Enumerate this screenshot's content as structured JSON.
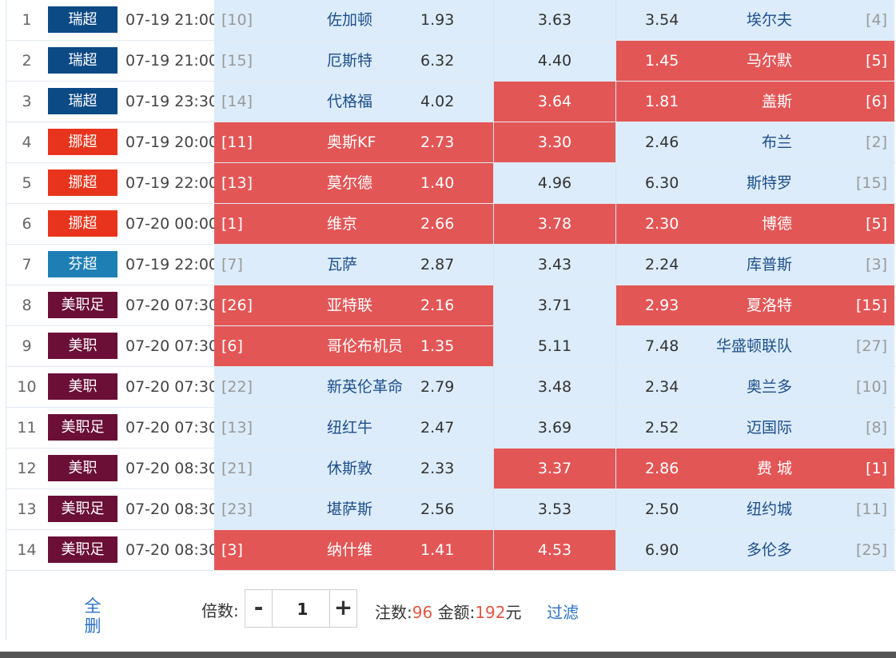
{
  "colors": {
    "league_瑞超": "#0c4a86",
    "league_挪超": "#e8341c",
    "league_芬超": "#1e7fb4",
    "league_美职": "#6b0f37",
    "cell_normal": "#dcecfa",
    "cell_selected": "#e35656"
  },
  "matches": [
    {
      "idx": "1",
      "league": "瑞超",
      "league_color": "#0c4a86",
      "time": "07-19 21:00",
      "home_rank": "[10]",
      "home_team": "佐加顿",
      "home_odds": "1.93",
      "draw_odds": "3.63",
      "away_odds": "3.54",
      "away_team": "埃尔夫",
      "away_rank": "[4]",
      "home_sel": false,
      "draw_sel": false,
      "away_sel": false
    },
    {
      "idx": "2",
      "league": "瑞超",
      "league_color": "#0c4a86",
      "time": "07-19 21:00",
      "home_rank": "[15]",
      "home_team": "厄斯特",
      "home_odds": "6.32",
      "draw_odds": "4.40",
      "away_odds": "1.45",
      "away_team": "马尔默",
      "away_rank": "[5]",
      "home_sel": false,
      "draw_sel": false,
      "away_sel": true
    },
    {
      "idx": "3",
      "league": "瑞超",
      "league_color": "#0c4a86",
      "time": "07-19 23:30",
      "home_rank": "[14]",
      "home_team": "代格福",
      "home_odds": "4.02",
      "draw_odds": "3.64",
      "away_odds": "1.81",
      "away_team": "盖斯",
      "away_rank": "[6]",
      "home_sel": false,
      "draw_sel": true,
      "away_sel": true
    },
    {
      "idx": "4",
      "league": "挪超",
      "league_color": "#e8341c",
      "time": "07-19 20:00",
      "home_rank": "[11]",
      "home_team": "奥斯KF",
      "home_odds": "2.73",
      "draw_odds": "3.30",
      "away_odds": "2.46",
      "away_team": "布兰",
      "away_rank": "[2]",
      "home_sel": true,
      "draw_sel": true,
      "away_sel": false
    },
    {
      "idx": "5",
      "league": "挪超",
      "league_color": "#e8341c",
      "time": "07-19 22:00",
      "home_rank": "[13]",
      "home_team": "莫尔德",
      "home_odds": "1.40",
      "draw_odds": "4.96",
      "away_odds": "6.30",
      "away_team": "斯特罗",
      "away_rank": "[15]",
      "home_sel": true,
      "draw_sel": false,
      "away_sel": false
    },
    {
      "idx": "6",
      "league": "挪超",
      "league_color": "#e8341c",
      "time": "07-20 00:00",
      "home_rank": "[1]",
      "home_team": "维京",
      "home_odds": "2.66",
      "draw_odds": "3.78",
      "away_odds": "2.30",
      "away_team": "博德",
      "away_rank": "[5]",
      "home_sel": true,
      "draw_sel": true,
      "away_sel": true
    },
    {
      "idx": "7",
      "league": "芬超",
      "league_color": "#1e7fb4",
      "time": "07-19 22:00",
      "home_rank": "[7]",
      "home_team": "瓦萨",
      "home_odds": "2.87",
      "draw_odds": "3.43",
      "away_odds": "2.24",
      "away_team": "库普斯",
      "away_rank": "[3]",
      "home_sel": false,
      "draw_sel": false,
      "away_sel": false
    },
    {
      "idx": "8",
      "league": "美职足",
      "league_color": "#6b0f37",
      "time": "07-20 07:30",
      "home_rank": "[26]",
      "home_team": "亚特联",
      "home_odds": "2.16",
      "draw_odds": "3.71",
      "away_odds": "2.93",
      "away_team": "夏洛特",
      "away_rank": "[15]",
      "home_sel": true,
      "draw_sel": false,
      "away_sel": true
    },
    {
      "idx": "9",
      "league": "美职",
      "league_color": "#6b0f37",
      "time": "07-20 07:30",
      "home_rank": "[6]",
      "home_team": "哥伦布机员",
      "home_odds": "1.35",
      "draw_odds": "5.11",
      "away_odds": "7.48",
      "away_team": "华盛顿联队",
      "away_rank": "[27]",
      "home_sel": true,
      "draw_sel": false,
      "away_sel": false
    },
    {
      "idx": "10",
      "league": "美职",
      "league_color": "#6b0f37",
      "time": "07-20 07:30",
      "home_rank": "[22]",
      "home_team": "新英伦革命",
      "home_odds": "2.79",
      "draw_odds": "3.48",
      "away_odds": "2.34",
      "away_team": "奥兰多",
      "away_rank": "[10]",
      "home_sel": false,
      "draw_sel": false,
      "away_sel": false
    },
    {
      "idx": "11",
      "league": "美职足",
      "league_color": "#6b0f37",
      "time": "07-20 07:30",
      "home_rank": "[13]",
      "home_team": "纽红牛",
      "home_odds": "2.47",
      "draw_odds": "3.69",
      "away_odds": "2.52",
      "away_team": "迈国际",
      "away_rank": "[8]",
      "home_sel": false,
      "draw_sel": false,
      "away_sel": false
    },
    {
      "idx": "12",
      "league": "美职",
      "league_color": "#6b0f37",
      "time": "07-20 08:30",
      "home_rank": "[21]",
      "home_team": "休斯敦",
      "home_odds": "2.33",
      "draw_odds": "3.37",
      "away_odds": "2.86",
      "away_team": "费 城",
      "away_rank": "[1]",
      "home_sel": false,
      "draw_sel": true,
      "away_sel": true
    },
    {
      "idx": "13",
      "league": "美职足",
      "league_color": "#6b0f37",
      "time": "07-20 08:30",
      "home_rank": "[23]",
      "home_team": "堪萨斯",
      "home_odds": "2.56",
      "draw_odds": "3.53",
      "away_odds": "2.50",
      "away_team": "纽约城",
      "away_rank": "[11]",
      "home_sel": false,
      "draw_sel": false,
      "away_sel": false
    },
    {
      "idx": "14",
      "league": "美职足",
      "league_color": "#6b0f37",
      "time": "07-20 08:30",
      "home_rank": "[3]",
      "home_team": "纳什维",
      "home_odds": "1.41",
      "draw_odds": "4.53",
      "away_odds": "6.90",
      "away_team": "多伦多",
      "away_rank": "[25]",
      "home_sel": true,
      "draw_sel": true,
      "away_sel": false
    }
  ],
  "footer": {
    "clear_all_line1": "全",
    "clear_all_line2": "删",
    "multiplier_label": "倍数:",
    "minus_label": "-",
    "plus_label": "+",
    "multiplier_value": "1",
    "bets_label": "注数:",
    "bets_value": "96",
    "amount_label": "金额:",
    "amount_value": "192",
    "amount_unit": "元",
    "filter_label": "过滤"
  }
}
